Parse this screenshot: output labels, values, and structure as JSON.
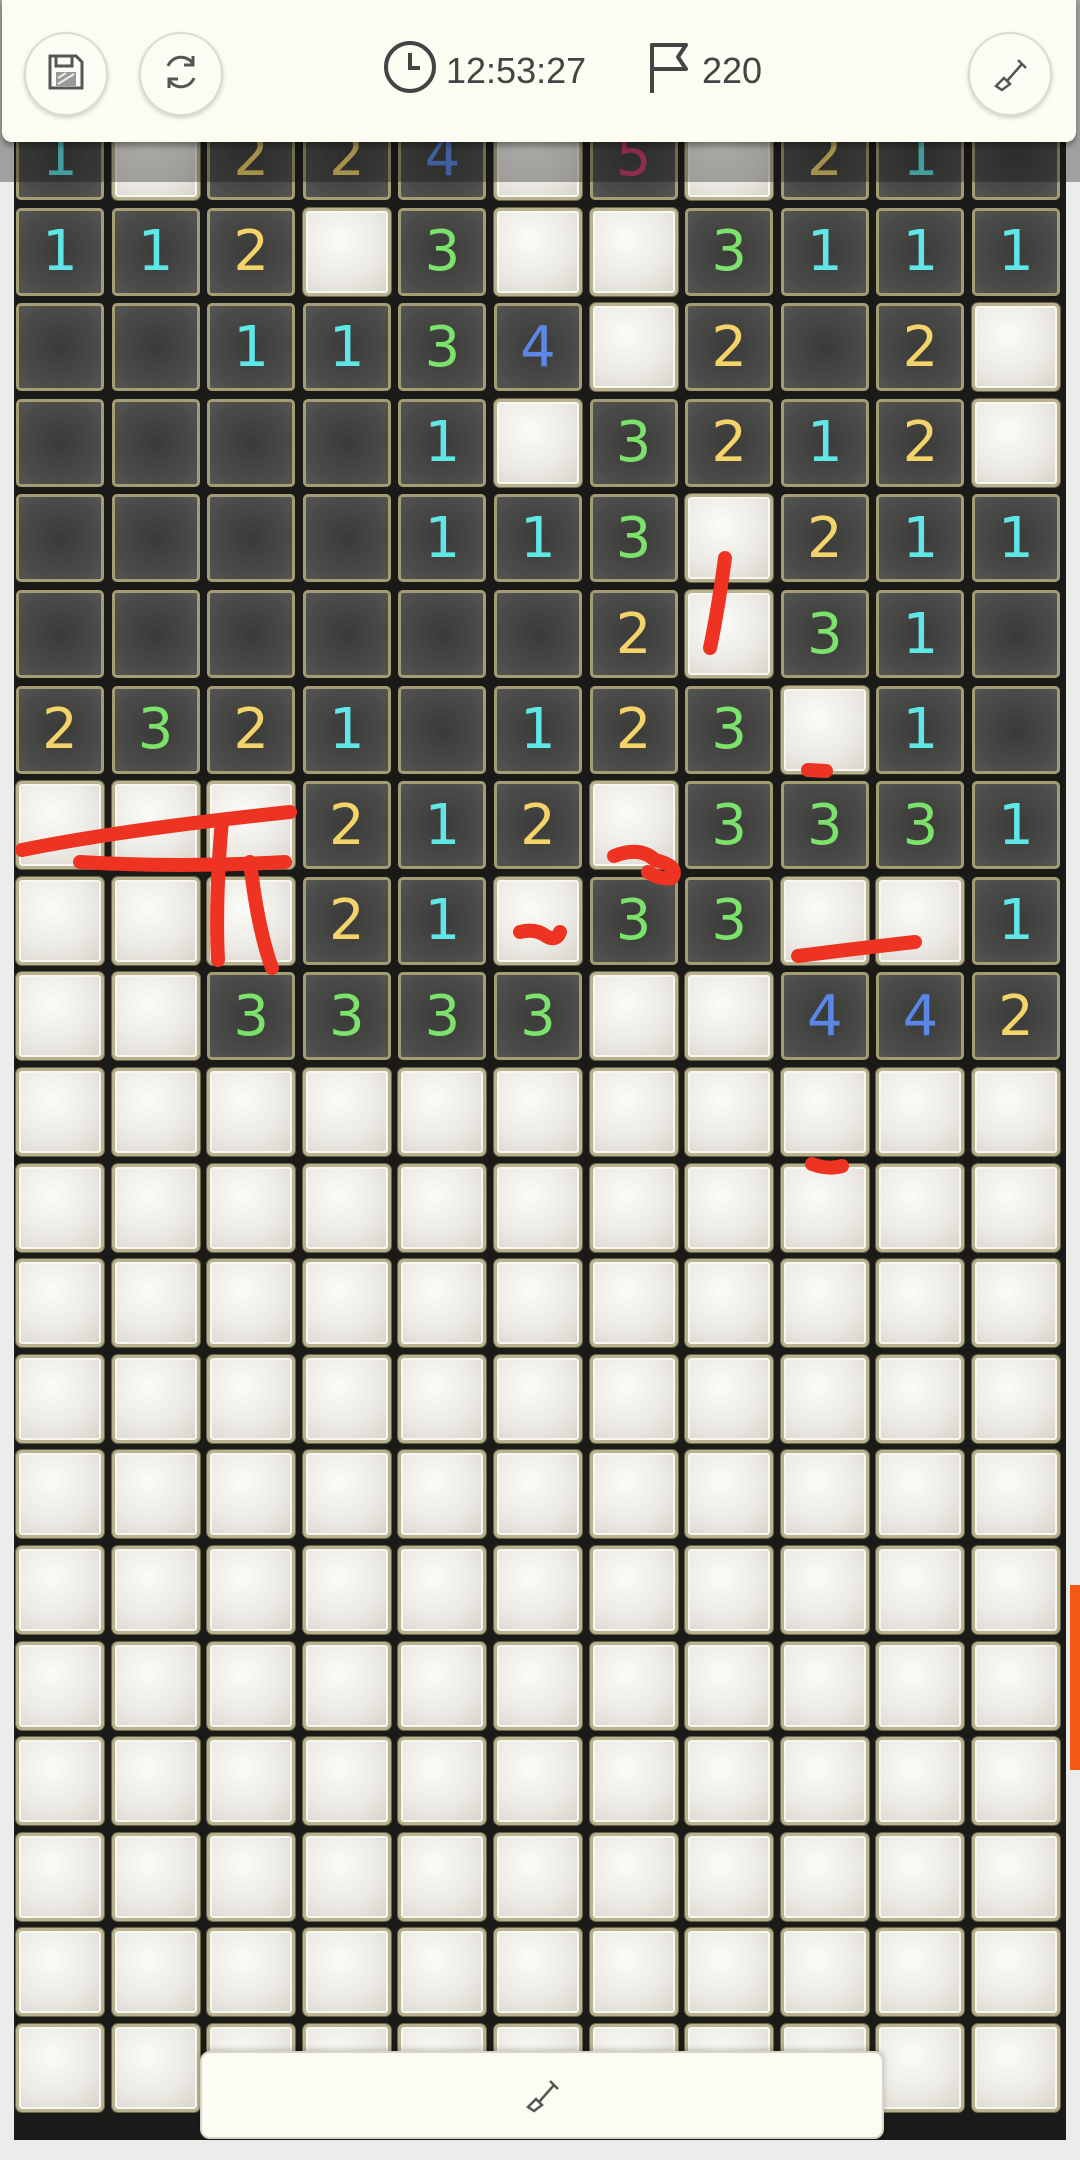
{
  "header": {
    "timer": "12:53:27",
    "flag_count": "220",
    "icons": {
      "save": "save-icon",
      "restart": "restart-icon",
      "timer": "clock-icon",
      "flags": "flag-icon",
      "mode": "shovel-icon"
    }
  },
  "bottom_bar": {
    "icon": "shovel-icon"
  },
  "board": {
    "columns": 11,
    "visible_rows": 21,
    "legend": {
      "C": "covered cell",
      ".": "revealed empty cell",
      "1-5": "revealed number"
    },
    "rows": [
      "1C224C5C21.",
      "112C3CC3111",
      "..1134C2.2C",
      "....1C3212C",
      "....113C211",
      "......2C31.",
      "2321.123C1.",
      "CCC212C3331",
      "CCC21C33CC1",
      "CC3333CC442",
      "CCCCCCCCCCC",
      "CCCCCCCCCCC",
      "CCCCCCCCCCC",
      "CCCCCCCCCCC",
      "CCCCCCCCCCC",
      "CCCCCCCCCCC",
      "CCCCCCCCCCC",
      "CCCCCCCCCCC",
      "CCCCCCCCCCC",
      "CCCCCCCCCCC",
      "CCCCCCCCCCC"
    ],
    "number_colors": {
      "1": "#5fe6e6",
      "2": "#f4d46a",
      "3": "#7be36b",
      "4": "#5a87e8",
      "5": "#d23a6c"
    }
  },
  "annotation_color": "#ee3322",
  "accent_color": "#f25a14"
}
